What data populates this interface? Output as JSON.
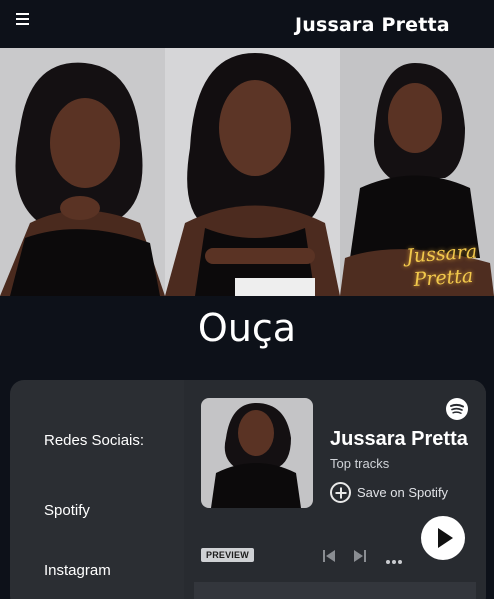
{
  "header": {
    "title": "Jussara Pretta"
  },
  "hero": {
    "signature_line1": "Jussara",
    "signature_line2": "Pretta"
  },
  "section": {
    "title": "Ouça"
  },
  "social": {
    "heading": "Redes Sociais:",
    "items": [
      {
        "label": "Spotify"
      },
      {
        "label": "Instagram"
      }
    ]
  },
  "spotify_embed": {
    "artist": "Jussara Pretta",
    "subtitle": "Top tracks",
    "save_label": "Save on Spotify",
    "preview_badge": "PREVIEW"
  },
  "colors": {
    "background": "#0d1119",
    "card": "#2b2e33",
    "signature_gold": "#f2c94c"
  }
}
